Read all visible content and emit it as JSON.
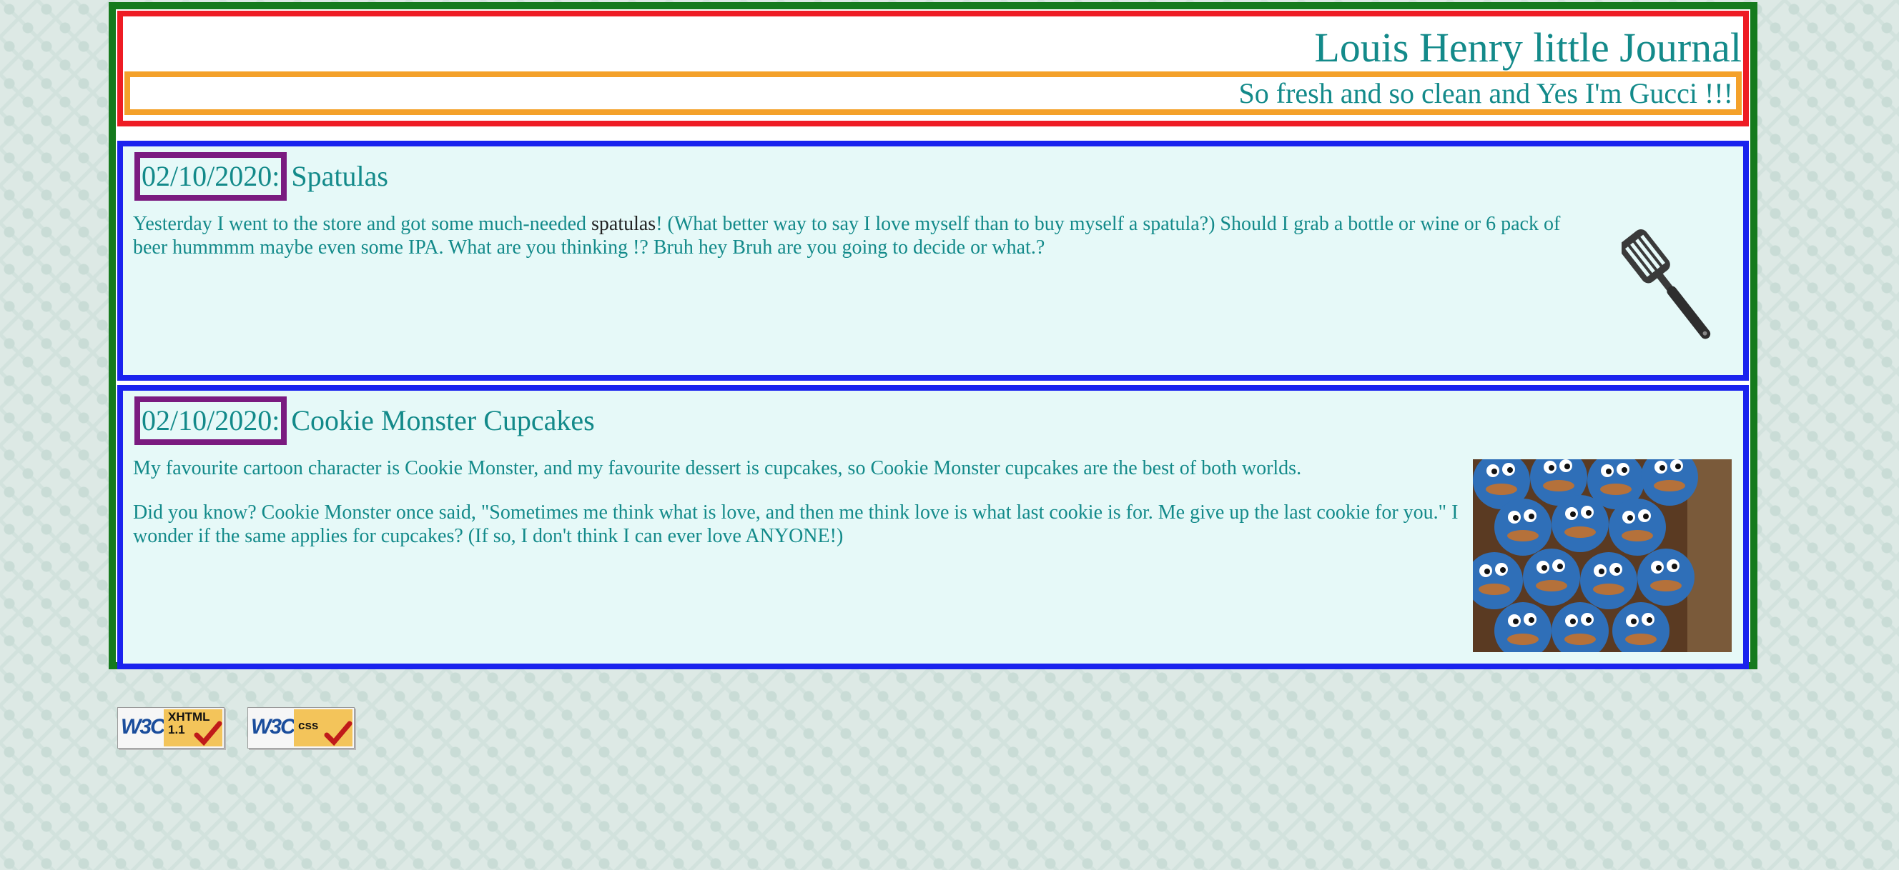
{
  "header": {
    "title": "Louis Henry little Journal",
    "tagline": "So fresh and so clean and Yes I'm Gucci !!!"
  },
  "posts": [
    {
      "date": "02/10/2020:",
      "title": "Spatulas",
      "body_before": "Yesterday I went to the store and got some much-needed ",
      "body_highlight": "spatulas",
      "body_after": "! (What better way to say I love myself than to buy myself a spatula?) Should I grab a bottle or wine or 6 pack of beer hummmm maybe even some IPA. What are you thinking !? Bruh hey Bruh are you going to decide or what.?",
      "image_icon": "spatula-icon"
    },
    {
      "date": "02/10/2020:",
      "title": "Cookie Monster Cupcakes",
      "paragraph1": "My favourite cartoon character is Cookie Monster, and my favourite dessert is cupcakes, so Cookie Monster cupcakes are the best of both worlds.",
      "paragraph2": "Did you know? Cookie Monster once said, \"Sometimes me think what is love, and then me think love is what last cookie is for. Me give up the last cookie for you.\" I wonder if the same applies for cupcakes? (If so, I don't think I can ever love ANYONE!)",
      "image_icon": "cupcakes-photo"
    }
  ],
  "badges": {
    "xhtml": {
      "logo": "W3C",
      "line1": "XHTML",
      "line2": "1.1"
    },
    "css": {
      "logo": "W3C",
      "line1": "css"
    }
  },
  "colors": {
    "text": "#138a8a",
    "wrapper_border": "#157a1d",
    "header_border": "#ee1c24",
    "tagline_border": "#f4a12a",
    "post_border": "#1a23ee",
    "date_border": "#7a1b80",
    "post_bg": "#e6f9f8"
  }
}
